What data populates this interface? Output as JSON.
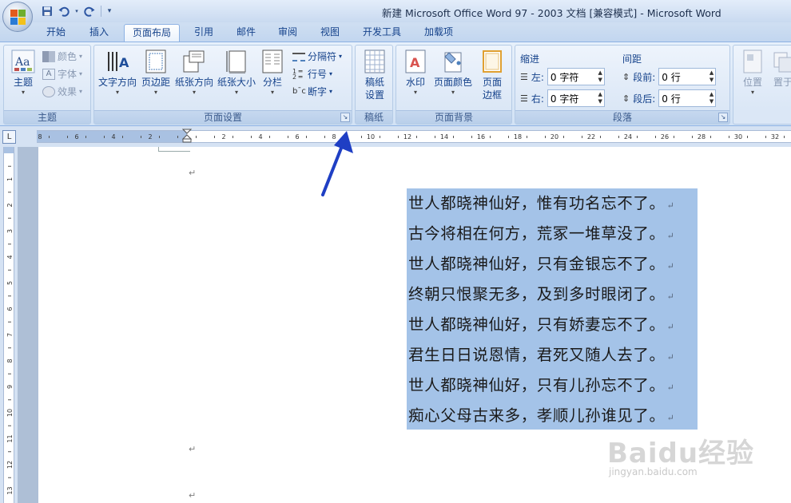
{
  "window": {
    "title": "新建 Microsoft Office Word 97 - 2003 文档 [兼容模式] - Microsoft Word"
  },
  "quick_access": {
    "save_icon": "save-icon",
    "undo_icon": "undo-icon",
    "redo_icon": "redo-icon",
    "customize_icon": "customize-icon"
  },
  "tabs": [
    {
      "label": "开始"
    },
    {
      "label": "插入"
    },
    {
      "label": "页面布局"
    },
    {
      "label": "引用"
    },
    {
      "label": "邮件"
    },
    {
      "label": "审阅"
    },
    {
      "label": "视图"
    },
    {
      "label": "开发工具"
    },
    {
      "label": "加载项"
    }
  ],
  "active_tab": "页面布局",
  "ribbon": {
    "themes": {
      "label": "主题",
      "themes_button": "主题",
      "colors": "颜色",
      "fonts": "字体",
      "effects": "效果"
    },
    "page_setup": {
      "label": "页面设置",
      "text_direction": "文字方向",
      "margins": "页边距",
      "orientation": "纸张方向",
      "size": "纸张大小",
      "columns": "分栏",
      "breaks": "分隔符",
      "line_numbers": "行号",
      "hyphenation": "断字"
    },
    "manuscript": {
      "label": "稿纸",
      "button_line1": "稿纸",
      "button_line2": "设置"
    },
    "page_background": {
      "label": "页面背景",
      "watermark": "水印",
      "page_color": "页面颜色",
      "borders_line1": "页面",
      "borders_line2": "边框"
    },
    "paragraph": {
      "label": "段落",
      "indent_title": "缩进",
      "spacing_title": "间距",
      "indent_left_label": "左:",
      "indent_left_value": "0 字符",
      "indent_right_label": "右:",
      "indent_right_value": "0 字符",
      "spacing_before_label": "段前:",
      "spacing_before_value": "0 行",
      "spacing_after_label": "段后:",
      "spacing_after_value": "0 行"
    },
    "arrange": {
      "position": "位置",
      "wrap": "置于"
    }
  },
  "ruler": {
    "tab_selector": "L",
    "negative_ticks": [
      "8",
      "6",
      "4",
      "2"
    ],
    "positive_ticks": [
      "2",
      "4",
      "6",
      "8",
      "10",
      "12",
      "14",
      "16",
      "18",
      "20",
      "22",
      "24",
      "26",
      "28",
      "30",
      "32"
    ],
    "vertical_ticks": [
      "1",
      "2",
      "3",
      "4",
      "5",
      "6",
      "7",
      "8",
      "9",
      "10",
      "11",
      "12",
      "13"
    ]
  },
  "document": {
    "paragraph_mark": "↵",
    "poem_lines": [
      "世人都晓神仙好，惟有功名忘不了。",
      "古今将相在何方，荒冢一堆草没了。",
      "世人都晓神仙好，只有金银忘不了。",
      "终朝只恨聚无多，及到多时眼闭了。",
      "世人都晓神仙好，只有娇妻忘不了。",
      "君生日日说恩情，君死又随人去了。",
      "世人都晓神仙好，只有儿孙忘不了。",
      "痴心父母古来多，孝顺儿孙谁见了。"
    ]
  },
  "watermark": {
    "brand": "Baidu经验",
    "url": "jingyan.baidu.com"
  },
  "colors": {
    "selection": "#a4c3e8",
    "ribbon_text": "#15428b",
    "annotation_arrow": "#1f3fc4"
  }
}
